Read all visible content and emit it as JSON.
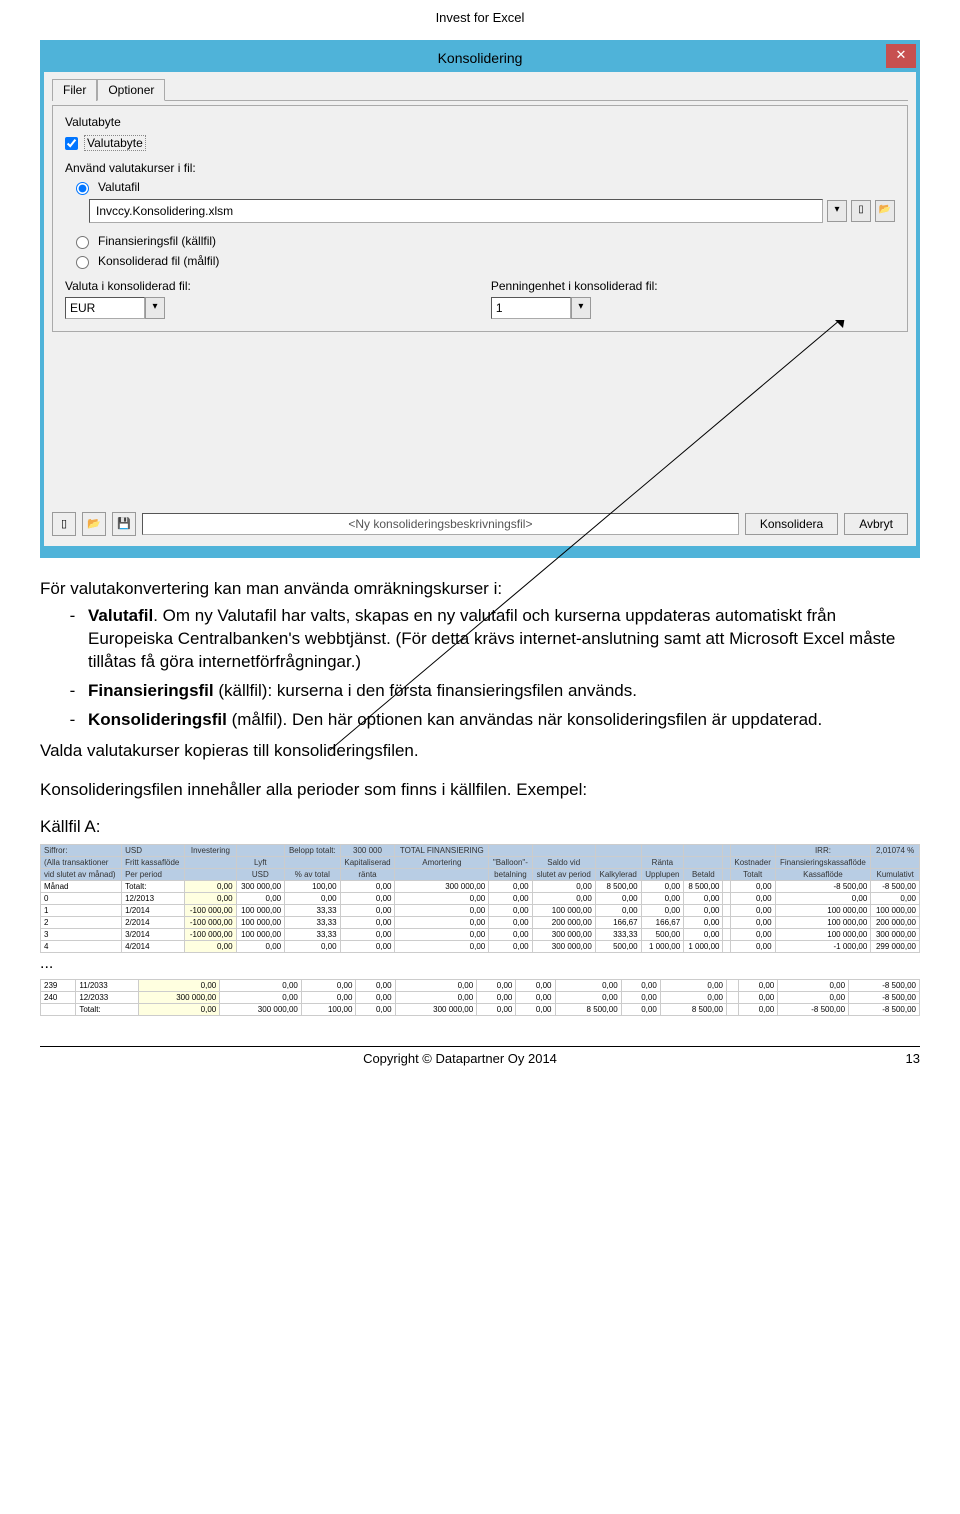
{
  "doc": {
    "header": "Invest for Excel",
    "footer_center": "Copyright © Datapartner Oy 2014",
    "footer_page": "13"
  },
  "dialog": {
    "title": "Konsolidering",
    "close_symbol": "✕",
    "tab_filer": "Filer",
    "tab_optioner": "Optioner",
    "group_legend": "Valutabyte",
    "cb_valutabyte": "Valutabyte",
    "lbl_use_rates": "Använd valutakurser i fil:",
    "rb_valutafil": "Valutafil",
    "file_path": "Invccy.Konsolidering.xlsm",
    "rb_finansfil": "Finansieringsfil (källfil)",
    "rb_konsolfil": "Konsoliderad fil (målfil)",
    "lbl_valuta": "Valuta i konsoliderad fil:",
    "val_valuta": "EUR",
    "lbl_penning": "Penningenhet i konsoliderad fil:",
    "val_penning": "1",
    "config_placeholder": "<Ny konsolideringsbeskrivningsfil>",
    "btn_konsolidera": "Konsolidera",
    "btn_avbryt": "Avbryt"
  },
  "text": {
    "intro": "För valutakonvertering kan man använda omräkningskurser i:",
    "li1_bold": "Valutafil",
    "li1_rest": ". Om ny Valutafil har valts, skapas en ny valutafil och kurserna uppdateras automatiskt från Europeiska Centralbanken's webbtjänst. (För detta krävs internet-anslutning samt att Microsoft Excel måste tillåtas få göra internetförfrågningar.)",
    "li2_bold": "Finansieringsfil",
    "li2_rest": " (källfil): kurserna i den första finansieringsfilen används.",
    "li3_bold": "Konsolideringsfil",
    "li3_rest": " (målfil). Den här optionen kan användas när konsolideringsfilen är uppdaterad.",
    "p2": "Valda valutakurser kopieras till konsolideringsfilen.",
    "p3": "Konsolideringsfilen innehåller alla perioder som finns i källfilen. Exempel:",
    "source_a": "Källfil A:",
    "dots": "..."
  },
  "table_a": {
    "hdr1": [
      "Siffror:",
      "USD",
      "Investering",
      "",
      "Belopp totalt:",
      "300 000",
      "TOTAL FINANSIERING",
      "",
      "",
      "",
      "",
      "",
      "",
      "",
      "IRR:",
      "2,01074 %"
    ],
    "hdr2a": [
      "(Alla transaktioner",
      "Fritt kassaflöde",
      "",
      "Lyft",
      "",
      "Kapitaliserad",
      "Amortering",
      "\"Balloon\"-",
      "Saldo vid",
      "",
      "Ränta",
      "",
      "",
      "Kostnader",
      "Finansieringskassaflöde",
      ""
    ],
    "hdr2b": [
      "vid slutet av månad)",
      "Per period",
      "",
      "USD",
      "% av total",
      "ränta",
      "",
      "betalning",
      "slutet av period",
      "Kalkylerad",
      "Upplupen",
      "Betald",
      "",
      "Totalt",
      "Kassaflöde",
      "Kumulativt"
    ],
    "rows": [
      [
        "Månad",
        "Totalt:",
        "0,00",
        "300 000,00",
        "100,00",
        "0,00",
        "300 000,00",
        "0,00",
        "0,00",
        "8 500,00",
        "0,00",
        "8 500,00",
        "",
        "0,00",
        "-8 500,00",
        "-8 500,00"
      ],
      [
        "0",
        "12/2013",
        "0,00",
        "0,00",
        "0,00",
        "0,00",
        "0,00",
        "0,00",
        "0,00",
        "0,00",
        "0,00",
        "0,00",
        "",
        "0,00",
        "0,00",
        "0,00"
      ],
      [
        "1",
        "1/2014",
        "-100 000,00",
        "100 000,00",
        "33,33",
        "0,00",
        "0,00",
        "0,00",
        "100 000,00",
        "0,00",
        "0,00",
        "0,00",
        "",
        "0,00",
        "100 000,00",
        "100 000,00"
      ],
      [
        "2",
        "2/2014",
        "-100 000,00",
        "100 000,00",
        "33,33",
        "0,00",
        "0,00",
        "0,00",
        "200 000,00",
        "166,67",
        "166,67",
        "0,00",
        "",
        "0,00",
        "100 000,00",
        "200 000,00"
      ],
      [
        "3",
        "3/2014",
        "-100 000,00",
        "100 000,00",
        "33,33",
        "0,00",
        "0,00",
        "0,00",
        "300 000,00",
        "333,33",
        "500,00",
        "0,00",
        "",
        "0,00",
        "100 000,00",
        "300 000,00"
      ],
      [
        "4",
        "4/2014",
        "0,00",
        "0,00",
        "0,00",
        "0,00",
        "0,00",
        "0,00",
        "300 000,00",
        "500,00",
        "1 000,00",
        "1 000,00",
        "",
        "0,00",
        "-1 000,00",
        "299 000,00"
      ]
    ]
  },
  "table_b": {
    "rows": [
      [
        "239",
        "11/2033",
        "0,00",
        "0,00",
        "0,00",
        "0,00",
        "0,00",
        "0,00",
        "0,00",
        "0,00",
        "0,00",
        "0,00",
        "",
        "0,00",
        "0,00",
        "-8 500,00"
      ],
      [
        "240",
        "12/2033",
        "300 000,00",
        "0,00",
        "0,00",
        "0,00",
        "0,00",
        "0,00",
        "0,00",
        "0,00",
        "0,00",
        "0,00",
        "",
        "0,00",
        "0,00",
        "-8 500,00"
      ],
      [
        "",
        "Totalt:",
        "0,00",
        "300 000,00",
        "100,00",
        "0,00",
        "300 000,00",
        "0,00",
        "0,00",
        "8 500,00",
        "0,00",
        "8 500,00",
        "",
        "0,00",
        "-8 500,00",
        "-8 500,00"
      ]
    ]
  }
}
